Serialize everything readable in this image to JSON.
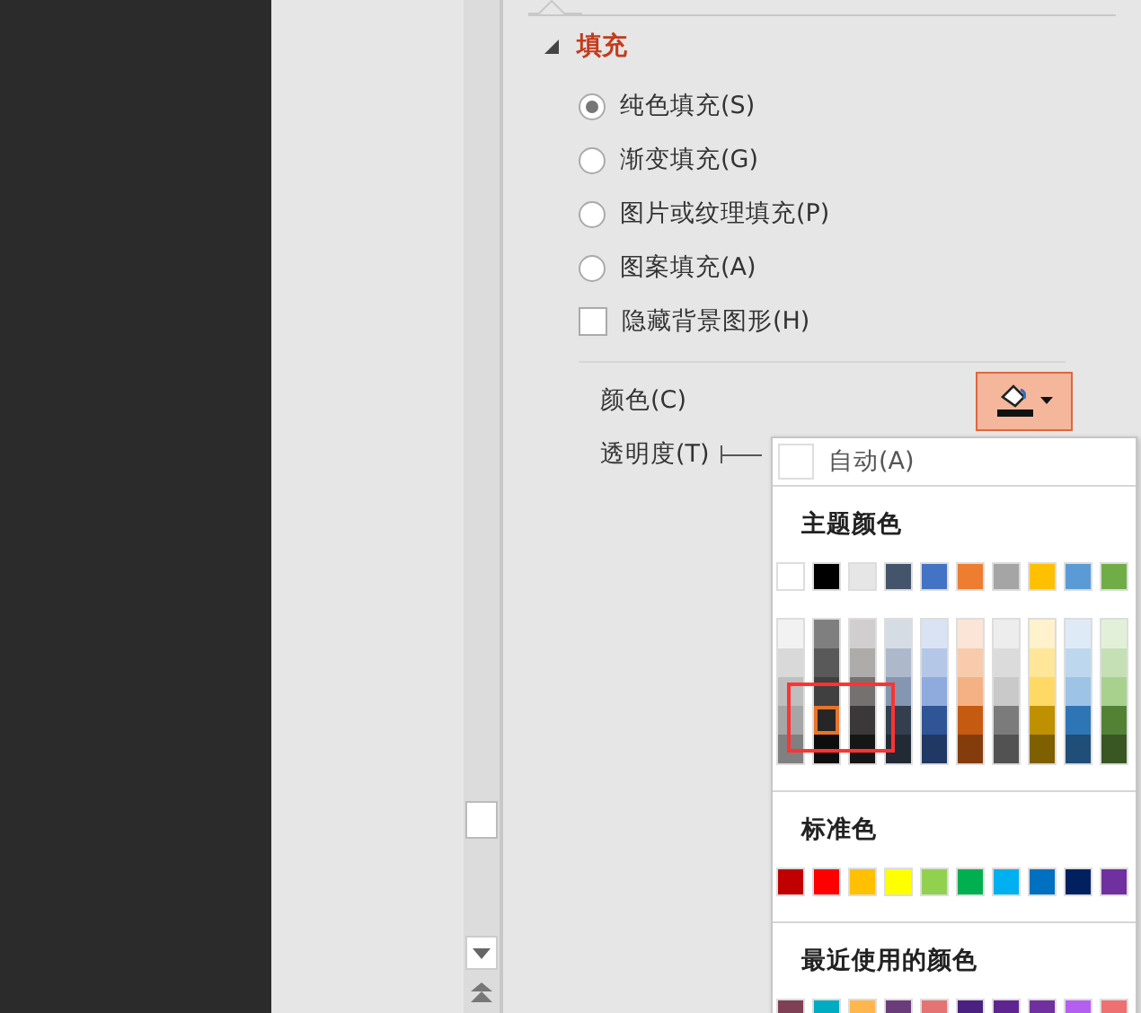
{
  "section": {
    "title": "填充",
    "expanded": true
  },
  "fill_options": [
    {
      "kind": "radio",
      "label": "纯色填充(S)",
      "selected": true
    },
    {
      "kind": "radio",
      "label": "渐变填充(G)",
      "selected": false
    },
    {
      "kind": "radio",
      "label": "图片或纹理填充(P)",
      "selected": false
    },
    {
      "kind": "radio",
      "label": "图案填充(A)",
      "selected": false
    },
    {
      "kind": "checkbox",
      "label": "隐藏背景图形(H)",
      "checked": false
    }
  ],
  "color_label": "颜色(C)",
  "transparency_label": "透明度(T)",
  "color_menu": {
    "auto_label": "自动(A)",
    "theme_title": "主题颜色",
    "theme_colors": [
      {
        "color": "#ffffff"
      },
      {
        "color": "#000000"
      },
      {
        "color": "#e7e6e6"
      },
      {
        "color": "#44546a"
      },
      {
        "color": "#4472c4"
      },
      {
        "color": "#ed7d31"
      },
      {
        "color": "#a5a5a5"
      },
      {
        "color": "#ffc000"
      },
      {
        "color": "#5b9bd5"
      },
      {
        "color": "#70ad47"
      }
    ],
    "theme_shades": [
      [
        {
          "color": "#f2f2f2",
          "selected": false
        },
        {
          "color": "#d9d9d9",
          "selected": false
        },
        {
          "color": "#bfbfbf",
          "selected": false
        },
        {
          "color": "#a6a6a6",
          "selected": false
        },
        {
          "color": "#808080",
          "selected": false
        }
      ],
      [
        {
          "color": "#7f7f7f",
          "selected": false
        },
        {
          "color": "#595959",
          "selected": false
        },
        {
          "color": "#404040",
          "selected": false
        },
        {
          "color": "#262626",
          "selected": true
        },
        {
          "color": "#0d0d0d",
          "selected": false
        }
      ],
      [
        {
          "color": "#d0cece",
          "selected": false
        },
        {
          "color": "#aeabab",
          "selected": false
        },
        {
          "color": "#757171",
          "selected": false
        },
        {
          "color": "#3a3838",
          "selected": false
        },
        {
          "color": "#171616",
          "selected": false
        }
      ],
      [
        {
          "color": "#d6dce4",
          "selected": false
        },
        {
          "color": "#adb9ca",
          "selected": false
        },
        {
          "color": "#8496b0",
          "selected": false
        },
        {
          "color": "#333f4f",
          "selected": false
        },
        {
          "color": "#222a35",
          "selected": false
        }
      ],
      [
        {
          "color": "#dae3f3",
          "selected": false
        },
        {
          "color": "#b4c7e7",
          "selected": false
        },
        {
          "color": "#8faadc",
          "selected": false
        },
        {
          "color": "#2f5597",
          "selected": false
        },
        {
          "color": "#1f3864",
          "selected": false
        }
      ],
      [
        {
          "color": "#fbe5d6",
          "selected": false
        },
        {
          "color": "#f8cbad",
          "selected": false
        },
        {
          "color": "#f4b183",
          "selected": false
        },
        {
          "color": "#c55a11",
          "selected": false
        },
        {
          "color": "#843c0c",
          "selected": false
        }
      ],
      [
        {
          "color": "#ededed",
          "selected": false
        },
        {
          "color": "#dbdbdb",
          "selected": false
        },
        {
          "color": "#c9c9c9",
          "selected": false
        },
        {
          "color": "#7b7b7b",
          "selected": false
        },
        {
          "color": "#525252",
          "selected": false
        }
      ],
      [
        {
          "color": "#fff2cc",
          "selected": false
        },
        {
          "color": "#ffe699",
          "selected": false
        },
        {
          "color": "#ffd966",
          "selected": false
        },
        {
          "color": "#bf9000",
          "selected": false
        },
        {
          "color": "#7f6000",
          "selected": false
        }
      ],
      [
        {
          "color": "#deebf7",
          "selected": false
        },
        {
          "color": "#bdd7ee",
          "selected": false
        },
        {
          "color": "#9dc3e6",
          "selected": false
        },
        {
          "color": "#2e75b6",
          "selected": false
        },
        {
          "color": "#1f4e79",
          "selected": false
        }
      ],
      [
        {
          "color": "#e2f0d9",
          "selected": false
        },
        {
          "color": "#c5e0b4",
          "selected": false
        },
        {
          "color": "#a9d18e",
          "selected": false
        },
        {
          "color": "#548235",
          "selected": false
        },
        {
          "color": "#385723",
          "selected": false
        }
      ]
    ],
    "standard_title": "标准色",
    "standard_colors": [
      {
        "color": "#c00000"
      },
      {
        "color": "#ff0000"
      },
      {
        "color": "#ffc000"
      },
      {
        "color": "#ffff00"
      },
      {
        "color": "#92d050"
      },
      {
        "color": "#00b050"
      },
      {
        "color": "#00b0f0"
      },
      {
        "color": "#0070c0"
      },
      {
        "color": "#002060"
      },
      {
        "color": "#7030a0"
      }
    ],
    "recent_title": "最近使用的颜色",
    "recent_colors": [
      {
        "color": "#7f3f55"
      },
      {
        "color": "#00acc1"
      },
      {
        "color": "#ffb74d"
      },
      {
        "color": "#6a3d7a"
      },
      {
        "color": "#e57373"
      },
      {
        "color": "#4a2080"
      },
      {
        "color": "#5e2590"
      },
      {
        "color": "#7030a0"
      },
      {
        "color": "#b55ff0"
      },
      {
        "color": "#ee7070"
      }
    ]
  }
}
